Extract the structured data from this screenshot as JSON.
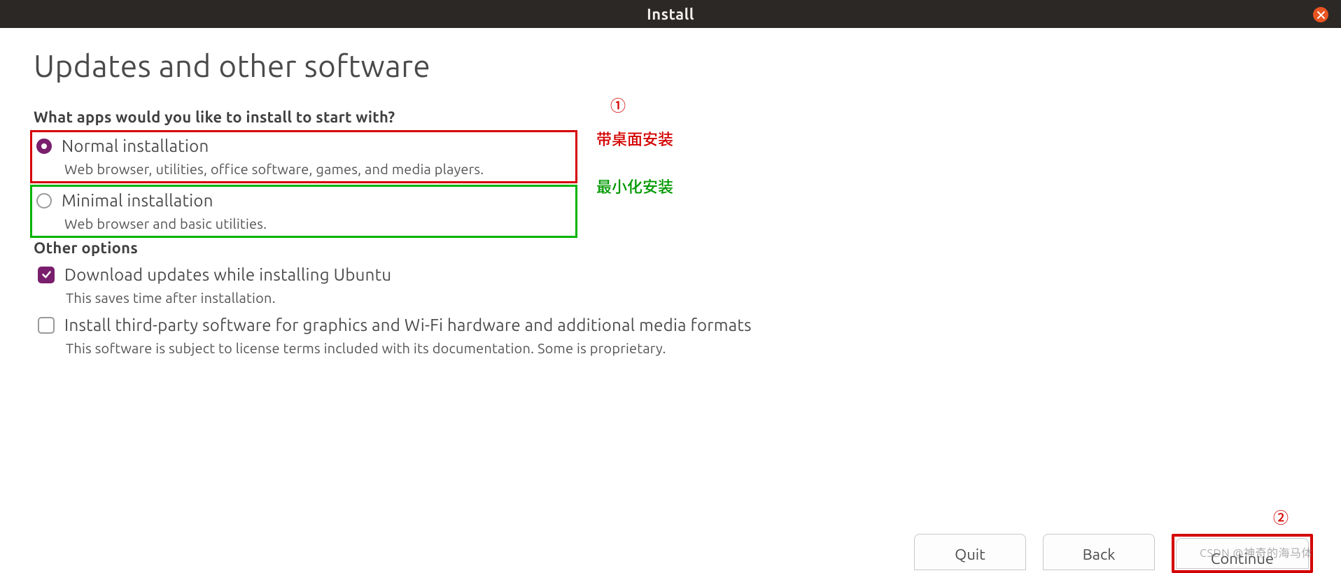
{
  "window": {
    "title": "Install"
  },
  "heading": "Updates and other software",
  "question": "What apps would you like to install to start with?",
  "options": {
    "normal": {
      "label": "Normal installation",
      "desc": "Web browser, utilities, office software, games, and media players."
    },
    "minimal": {
      "label": "Minimal installation",
      "desc": "Web browser and basic utilities."
    }
  },
  "other_heading": "Other options",
  "checks": {
    "updates": {
      "label": "Download updates while installing Ubuntu",
      "desc": "This saves time after installation."
    },
    "thirdparty": {
      "label": "Install third-party software for graphics and Wi-Fi hardware and additional media formats",
      "desc": "This software is subject to license terms included with its documentation. Some is proprietary."
    }
  },
  "annotations": {
    "marker1": "①",
    "marker2": "②",
    "normal_note": "带桌面安装",
    "minimal_note": "最小化安装"
  },
  "buttons": {
    "quit": "Quit",
    "back": "Back",
    "continue": "Continue"
  },
  "watermark": "CSDN @神奇的海马体"
}
